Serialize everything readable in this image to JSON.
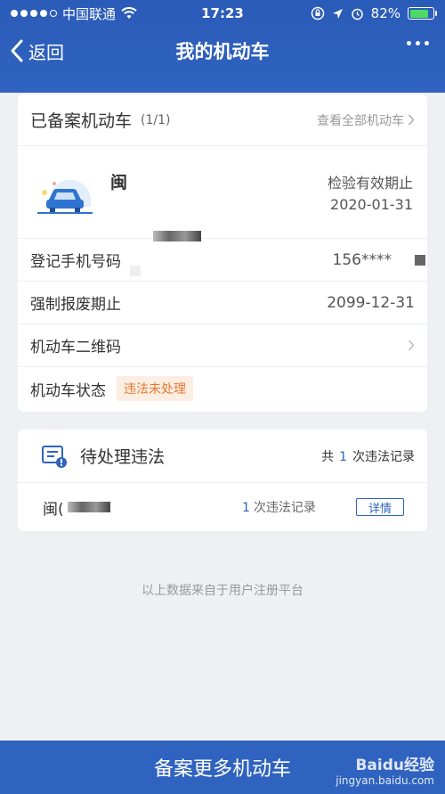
{
  "status_bar": {
    "carrier": "中国联通",
    "time": "17:23",
    "battery": "82%"
  },
  "nav": {
    "back_label": "返回",
    "title": "我的机动车"
  },
  "vehicle_card": {
    "title": "已备案机动车",
    "count": "(1/1)",
    "view_all": "查看全部机动车",
    "plate_prefix": "闽",
    "inspection_label": "检验有效期止",
    "inspection_date": "2020-01-31",
    "rows": [
      {
        "label": "登记手机号码",
        "value": "156****"
      },
      {
        "label": "强制报废期止",
        "value": "2099-12-31"
      },
      {
        "label": "机动车二维码"
      },
      {
        "label": "机动车状态",
        "badge": "违法未处理"
      }
    ]
  },
  "violation_card": {
    "title": "待处理违法",
    "total_prefix": "共",
    "total_count": "1",
    "total_suffix": "次违法记录",
    "plate": "闽(",
    "record_count": "1",
    "record_suffix": "次违法记录",
    "detail_label": "详情"
  },
  "footnote": "以上数据来自于用户注册平台",
  "bottom_button": "备案更多机动车",
  "watermark": {
    "brand": "Baidu经验",
    "url": "jingyan.baidu.com"
  },
  "colors": {
    "primary": "#2f63bf",
    "badge_text": "#e8782e",
    "badge_bg": "#fdeee3",
    "battery": "#4cd964"
  }
}
